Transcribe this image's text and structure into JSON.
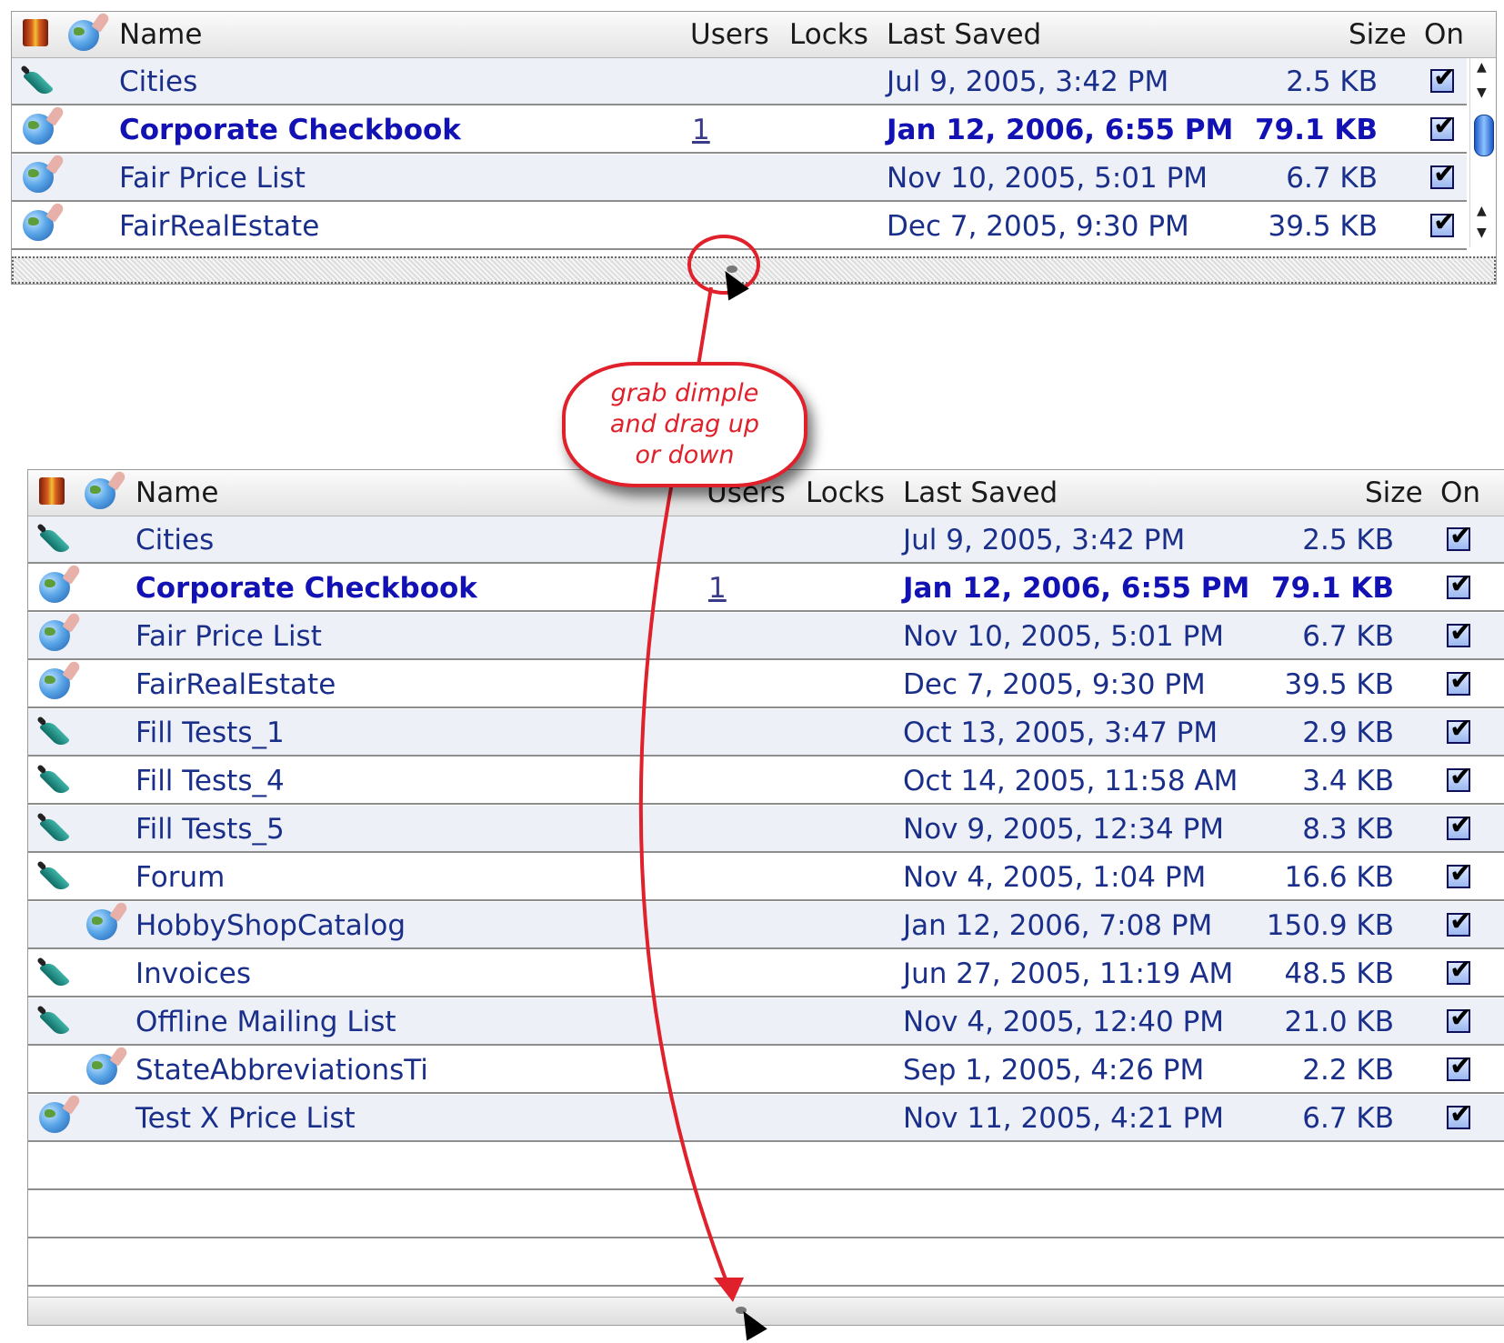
{
  "columns": {
    "name": "Name",
    "users": "Users",
    "locks": "Locks",
    "last_saved": "Last Saved",
    "size": "Size",
    "on": "On"
  },
  "callout": {
    "line1": "grab dimple",
    "line2": "and drag up",
    "line3": "or down"
  },
  "colors": {
    "accent": "#e0202a",
    "link": "#1a2f8a",
    "bold_link": "#1212b4"
  },
  "top_table": {
    "rows": [
      {
        "icon": "quill-icon",
        "name": "Cities",
        "users": "",
        "last_saved": "Jul 9, 2005, 3:42 PM",
        "size": "2.5 KB",
        "on": true,
        "bold": false
      },
      {
        "icon": "globe-icon",
        "name": "Corporate Checkbook",
        "users": "1",
        "last_saved": "Jan 12, 2006, 6:55 PM",
        "size": "79.1 KB",
        "on": true,
        "bold": true
      },
      {
        "icon": "globe-icon",
        "name": "Fair Price List",
        "users": "",
        "last_saved": "Nov 10, 2005, 5:01 PM",
        "size": "6.7 KB",
        "on": true,
        "bold": false
      },
      {
        "icon": "globe-icon",
        "name": "FairRealEstate",
        "users": "",
        "last_saved": "Dec 7, 2005, 9:30 PM",
        "size": "39.5 KB",
        "on": true,
        "bold": false
      }
    ]
  },
  "bottom_table": {
    "rows": [
      {
        "icon": "quill-icon",
        "name": "Cities",
        "users": "",
        "last_saved": "Jul 9, 2005, 3:42 PM",
        "size": "2.5 KB",
        "on": true,
        "bold": false,
        "indent": false
      },
      {
        "icon": "globe-icon",
        "name": "Corporate Checkbook",
        "users": "1",
        "last_saved": "Jan 12, 2006, 6:55 PM",
        "size": "79.1 KB",
        "on": true,
        "bold": true,
        "indent": false
      },
      {
        "icon": "globe-icon",
        "name": "Fair Price List",
        "users": "",
        "last_saved": "Nov 10, 2005, 5:01 PM",
        "size": "6.7 KB",
        "on": true,
        "bold": false,
        "indent": false
      },
      {
        "icon": "globe-icon",
        "name": "FairRealEstate",
        "users": "",
        "last_saved": "Dec 7, 2005, 9:30 PM",
        "size": "39.5 KB",
        "on": true,
        "bold": false,
        "indent": false
      },
      {
        "icon": "quill-icon",
        "name": "Fill Tests_1",
        "users": "",
        "last_saved": "Oct 13, 2005, 3:47 PM",
        "size": "2.9 KB",
        "on": true,
        "bold": false,
        "indent": false
      },
      {
        "icon": "quill-icon",
        "name": "Fill Tests_4",
        "users": "",
        "last_saved": "Oct 14, 2005, 11:58 AM",
        "size": "3.4 KB",
        "on": true,
        "bold": false,
        "indent": false
      },
      {
        "icon": "quill-icon",
        "name": "Fill Tests_5",
        "users": "",
        "last_saved": "Nov 9, 2005, 12:34 PM",
        "size": "8.3 KB",
        "on": true,
        "bold": false,
        "indent": false
      },
      {
        "icon": "quill-icon",
        "name": "Forum",
        "users": "",
        "last_saved": "Nov 4, 2005, 1:04 PM",
        "size": "16.6 KB",
        "on": true,
        "bold": false,
        "indent": false
      },
      {
        "icon": "globe-icon",
        "name": "HobbyShopCatalog",
        "users": "",
        "last_saved": "Jan 12, 2006, 7:08 PM",
        "size": "150.9 KB",
        "on": true,
        "bold": false,
        "indent": true
      },
      {
        "icon": "quill-icon",
        "name": "Invoices",
        "users": "",
        "last_saved": "Jun 27, 2005, 11:19 AM",
        "size": "48.5 KB",
        "on": true,
        "bold": false,
        "indent": false
      },
      {
        "icon": "quill-icon",
        "name": "Offline Mailing List",
        "users": "",
        "last_saved": "Nov 4, 2005, 12:40 PM",
        "size": "21.0 KB",
        "on": true,
        "bold": false,
        "indent": false
      },
      {
        "icon": "globe-icon",
        "name": "StateAbbreviationsTi",
        "users": "",
        "last_saved": "Sep 1, 2005, 4:26 PM",
        "size": "2.2 KB",
        "on": true,
        "bold": false,
        "indent": true
      },
      {
        "icon": "globe-icon",
        "name": "Test X Price List",
        "users": "",
        "last_saved": "Nov 11, 2005, 4:21 PM",
        "size": "6.7 KB",
        "on": true,
        "bold": false,
        "indent": false
      }
    ],
    "empty_rows": 3
  }
}
